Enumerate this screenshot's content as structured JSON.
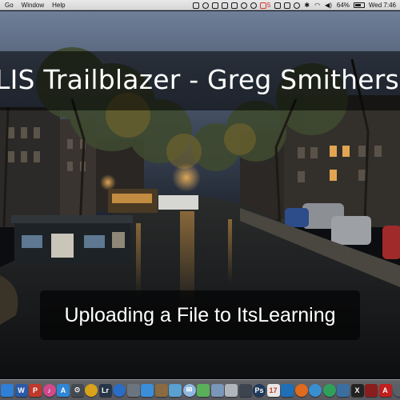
{
  "menubar": {
    "menus": [
      "Go",
      "Window",
      "Help"
    ],
    "notification_count": "5",
    "battery_percent": "64%",
    "clock": "Wed 7:46"
  },
  "slide": {
    "title": "LIS Trailblazer - Greg Smithers",
    "subtitle": "Uploading a File to ItsLearning"
  },
  "dock": {
    "apps": [
      {
        "name": "finder-icon",
        "color": "#2f7fd6",
        "glyph": ""
      },
      {
        "name": "word-icon",
        "color": "#2a5aa8",
        "glyph": "W"
      },
      {
        "name": "photo-app-icon",
        "color": "#c0392b",
        "glyph": "P"
      },
      {
        "name": "itunes-icon",
        "color": "#d04a8a",
        "glyph": "♪"
      },
      {
        "name": "app-store-icon",
        "color": "#2f86d4",
        "glyph": "A"
      },
      {
        "name": "system-icon",
        "color": "#444a52",
        "glyph": "⊙"
      },
      {
        "name": "chrome-icon",
        "color": "#d8a31a",
        "glyph": ""
      },
      {
        "name": "lightroom-icon",
        "color": "#263648",
        "glyph": "Lr"
      },
      {
        "name": "browser-icon",
        "color": "#2b6cc4",
        "glyph": ""
      },
      {
        "name": "app-icon-9",
        "color": "#6b7580",
        "glyph": ""
      },
      {
        "name": "safari-icon",
        "color": "#3b8fd8",
        "glyph": ""
      },
      {
        "name": "app-icon-11",
        "color": "#8a6a40",
        "glyph": ""
      },
      {
        "name": "photos-icon",
        "color": "#5aa0d0",
        "glyph": ""
      },
      {
        "name": "mail-icon",
        "color": "#8fb8e0",
        "glyph": "✉"
      },
      {
        "name": "maps-icon",
        "color": "#5ab05a",
        "glyph": ""
      },
      {
        "name": "preview-icon",
        "color": "#7a96b8",
        "glyph": ""
      },
      {
        "name": "app-icon-16",
        "color": "#b0b6be",
        "glyph": ""
      },
      {
        "name": "app-icon-17",
        "color": "#3c4450",
        "glyph": ""
      },
      {
        "name": "photoshop-icon",
        "color": "#1e3a5c",
        "glyph": "Ps"
      },
      {
        "name": "calendar-icon",
        "color": "#e8e8e8",
        "glyph": "17"
      },
      {
        "name": "app-icon-20",
        "color": "#1f6fb8",
        "glyph": ""
      },
      {
        "name": "firefox-icon",
        "color": "#e06a1e",
        "glyph": ""
      },
      {
        "name": "globe-icon",
        "color": "#3a8fd0",
        "glyph": ""
      },
      {
        "name": "app-icon-23",
        "color": "#2fa05a",
        "glyph": ""
      },
      {
        "name": "app-icon-24",
        "color": "#3a6fa0",
        "glyph": ""
      },
      {
        "name": "x-app-icon",
        "color": "#222222",
        "glyph": "X"
      },
      {
        "name": "app-icon-26",
        "color": "#8a1e1e",
        "glyph": ""
      },
      {
        "name": "acrobat-icon",
        "color": "#c21e1e",
        "glyph": "A"
      },
      {
        "name": "app-icon-28",
        "color": "#5a6068",
        "glyph": ""
      },
      {
        "name": "folder-icon-1",
        "color": "#d9dde3",
        "glyph": ""
      },
      {
        "name": "folder-icon-2",
        "color": "#c8ccd2",
        "glyph": ""
      },
      {
        "name": "folder-icon-3",
        "color": "#b8bcc3",
        "glyph": ""
      },
      {
        "name": "trash-icon",
        "color": "#9aa0a8",
        "glyph": ""
      }
    ]
  }
}
